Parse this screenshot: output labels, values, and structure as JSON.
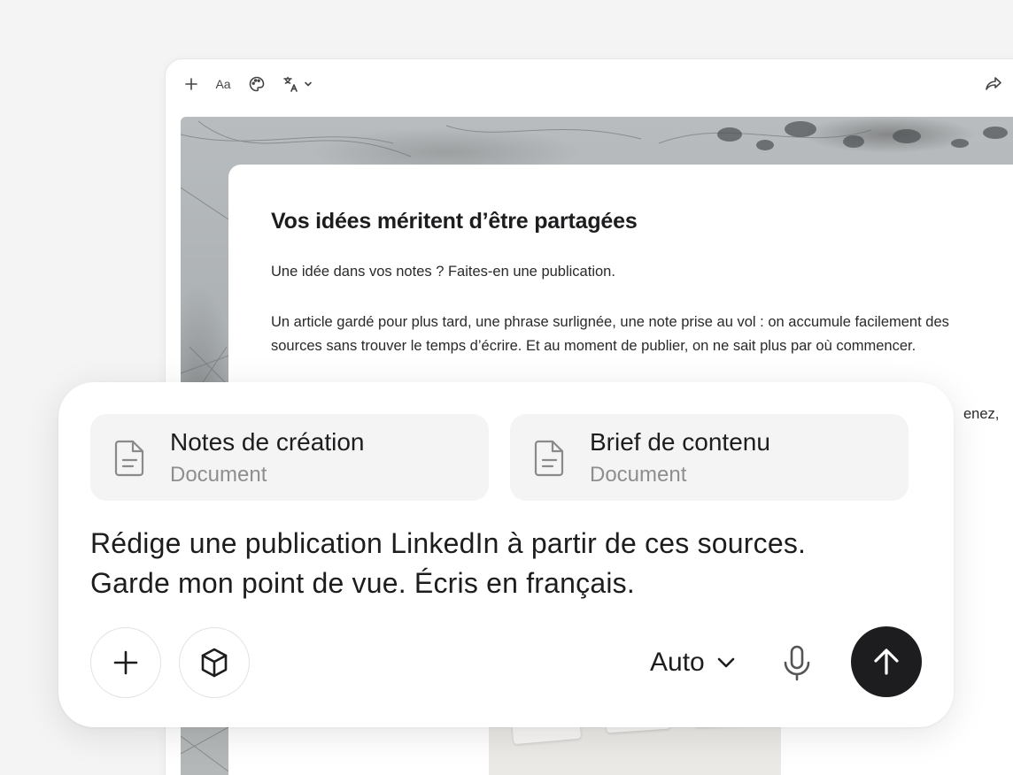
{
  "toolbar": {
    "add_icon": "plus-icon",
    "text_style_label": "Aa",
    "palette_icon": "palette-icon",
    "translate_icon": "translate-icon",
    "share_icon": "share-icon"
  },
  "document": {
    "title": "Vos idées méritent d’être partagées",
    "paragraph_1": "Une idée dans vos notes ? Faites-en une publication.",
    "paragraph_2": "Un article gardé pour plus tard, une phrase surlignée, une note prise au vol : on accumule facilement des sources sans trouver le temps d’écrire. Et au moment de publier, on ne sait plus par où commencer.",
    "paragraph_3_fragment": "enez,"
  },
  "composer": {
    "attachments": [
      {
        "name": "Notes de création",
        "type": "Document",
        "icon": "document-icon"
      },
      {
        "name": "Brief de contenu",
        "type": "Document",
        "icon": "document-icon"
      }
    ],
    "prompt_line_1": "Rédige une publication LinkedIn à partir de ces sources.",
    "prompt_line_2": "Garde mon point de vue. Écris en français.",
    "model": "Auto",
    "icons": {
      "add": "plus-icon",
      "tools": "cube-icon",
      "model_dropdown": "chevron-down-icon",
      "voice": "microphone-icon",
      "send": "arrow-up-icon"
    }
  },
  "colors": {
    "background": "#f4f4f4",
    "card": "#ffffff",
    "attachment_bg": "#f4f4f4",
    "send_button": "#1d1d1f",
    "muted_text": "#8e8e8e"
  }
}
